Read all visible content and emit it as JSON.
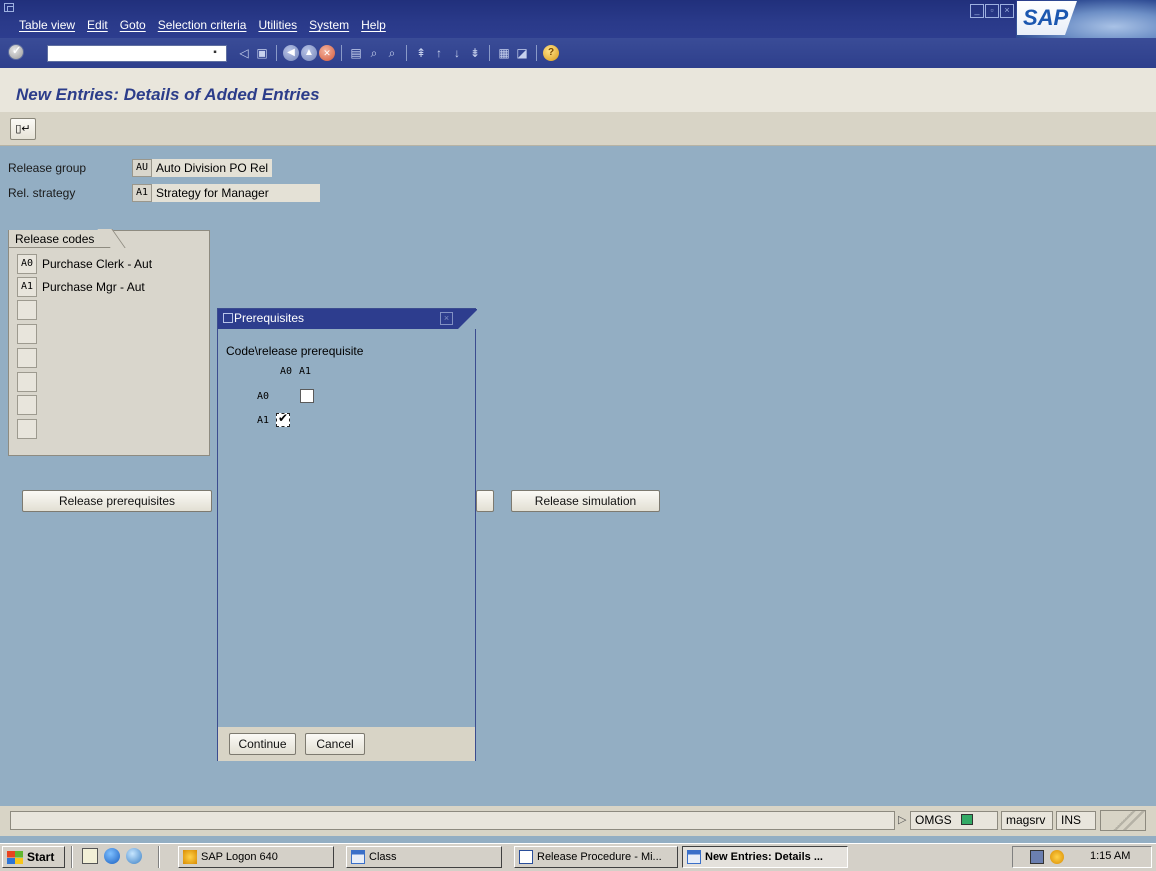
{
  "menubar": {
    "items": [
      "Table view",
      "Edit",
      "Goto",
      "Selection criteria",
      "Utilities",
      "System",
      "Help"
    ],
    "logo": "SAP"
  },
  "toolbar": {
    "command_field": "",
    "icons": [
      "enter-icon",
      "back-icon",
      "save-icon",
      "back-green-icon",
      "exit-icon",
      "cancel-icon",
      "print-icon",
      "find-icon",
      "find-next-icon",
      "first-page-icon",
      "previous-page-icon",
      "next-page-icon",
      "last-page-icon",
      "create-session-icon",
      "shortcut-icon",
      "help-icon"
    ]
  },
  "page": {
    "title": "New Entries: Details of Added Entries"
  },
  "header": {
    "release_group_label": "Release group",
    "release_group_code": "AU",
    "release_group_desc": "Auto Division PO Rel",
    "rel_strategy_label": "Rel. strategy",
    "rel_strategy_code": "A1",
    "rel_strategy_desc": "Strategy for Manager"
  },
  "release_codes": {
    "tab_label": "Release codes",
    "rows": [
      {
        "code": "A0",
        "text": "Purchase Clerk - Aut"
      },
      {
        "code": "A1",
        "text": "Purchase Mgr - Aut"
      }
    ]
  },
  "buttons": {
    "release_prerequisites": "Release prerequisites",
    "release_simulation": "Release simulation"
  },
  "popup": {
    "title": "Prerequisites",
    "heading": "Code\\release prerequisite",
    "col_headers": [
      "A0",
      "A1"
    ],
    "rows": [
      {
        "code": "A0",
        "checked": false
      },
      {
        "code": "A1",
        "checked": true
      }
    ],
    "continue_label": "Continue",
    "cancel_label": "Cancel"
  },
  "statusbar": {
    "system": "OMGS",
    "server": "magsrv",
    "mode": "INS"
  },
  "taskbar": {
    "start": "Start",
    "buttons": [
      "SAP Logon 640",
      "Class",
      "Release Procedure - Mi...",
      "New Entries: Details ..."
    ],
    "clock": "1:15 AM"
  },
  "colors": {
    "accent": "#2d3d8e",
    "background": "#93aec3",
    "panel": "#d8d4c6"
  }
}
